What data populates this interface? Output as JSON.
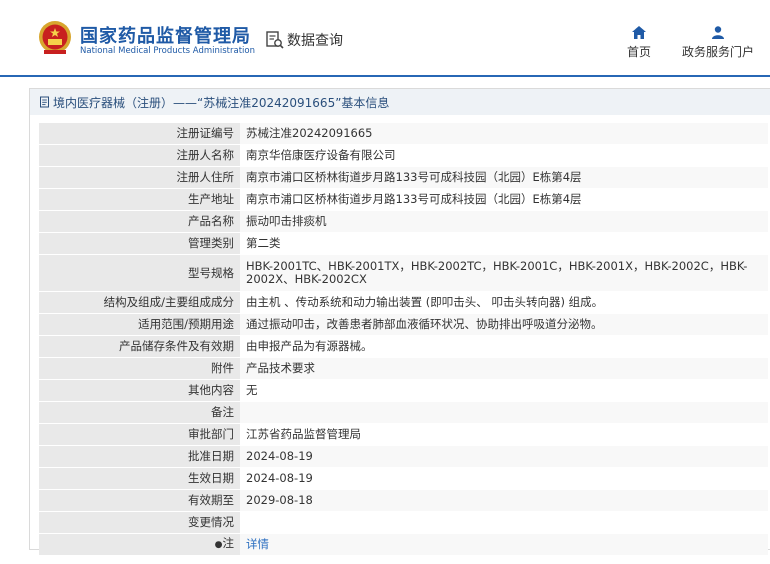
{
  "header": {
    "brand_cn": "国家药品监督管理局",
    "brand_en": "National Medical Products Administration",
    "search_label": "数据查询",
    "nav_home": "首页",
    "nav_portal": "政务服务门户"
  },
  "breadcrumb": "境内医疗器械（注册）——“苏械注准20242091665”基本信息",
  "rows": [
    {
      "k": "注册证编号",
      "v": "苏械注准20242091665"
    },
    {
      "k": "注册人名称",
      "v": "南京华倍康医疗设备有限公司"
    },
    {
      "k": "注册人住所",
      "v": "南京市浦口区桥林街道步月路133号可成科技园（北园）E栋第4层"
    },
    {
      "k": "生产地址",
      "v": "南京市浦口区桥林街道步月路133号可成科技园（北园）E栋第4层"
    },
    {
      "k": "产品名称",
      "v": "振动叩击排痰机"
    },
    {
      "k": "管理类别",
      "v": "第二类"
    },
    {
      "k": "型号规格",
      "v": "HBK-2001TC、HBK-2001TX，HBK-2002TC，HBK-2001C，HBK-2001X，HBK-2002C，HBK-2002X、HBK-2002CX"
    },
    {
      "k": "结构及组成/主要组成成分",
      "v": "由主机 、传动系统和动力输出装置 (即叩击头、 叩击头转向器) 组成。"
    },
    {
      "k": "适用范围/预期用途",
      "v": "通过振动叩击，改善患者肺部血液循环状况、协助排出呼吸道分泌物。"
    },
    {
      "k": "产品储存条件及有效期",
      "v": "由申报产品为有源器械。"
    },
    {
      "k": "附件",
      "v": "产品技术要求"
    },
    {
      "k": "其他内容",
      "v": "无"
    },
    {
      "k": "备注",
      "v": ""
    },
    {
      "k": "审批部门",
      "v": "江苏省药品监督管理局"
    },
    {
      "k": "批准日期",
      "v": "2024-08-19"
    },
    {
      "k": "生效日期",
      "v": "2024-08-19"
    },
    {
      "k": "有效期至",
      "v": "2029-08-18"
    },
    {
      "k": "变更情况",
      "v": ""
    },
    {
      "k": "注",
      "v": "详情"
    }
  ]
}
